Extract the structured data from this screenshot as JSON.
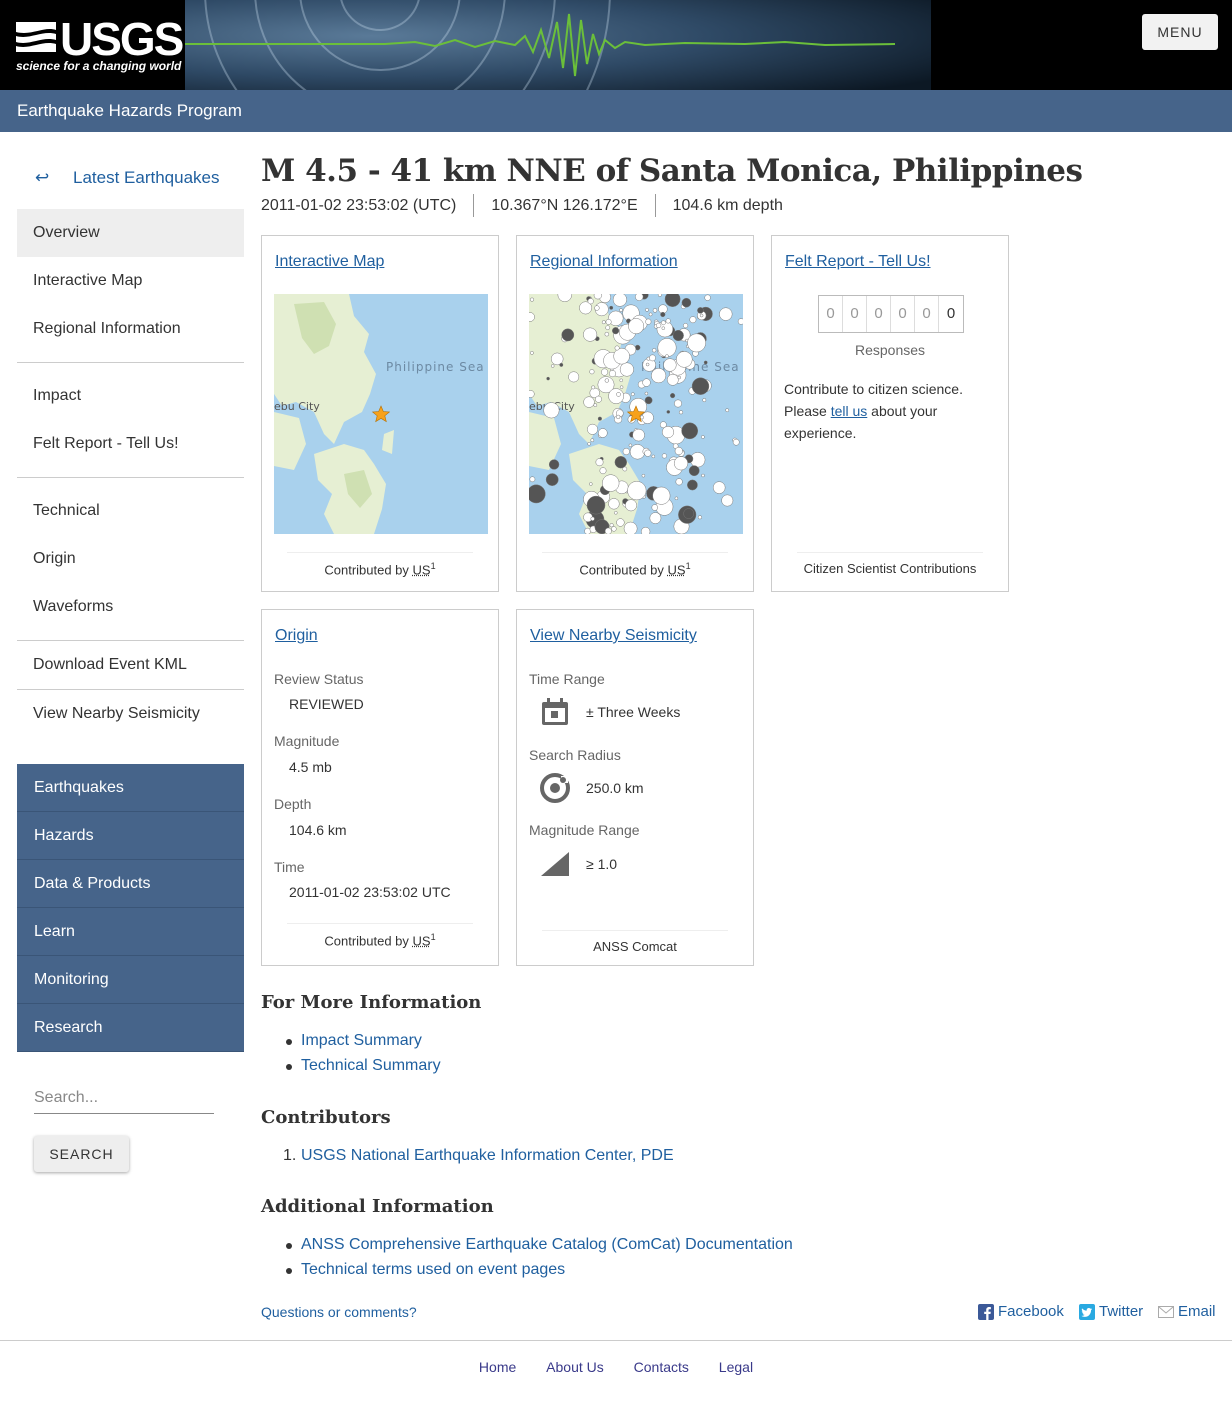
{
  "header": {
    "logo_text": "USGS",
    "logo_tagline": "science for a changing world",
    "menu_label": "MENU",
    "program_title": "Earthquake Hazards Program"
  },
  "sidebar": {
    "back_label": "Latest Earthquakes",
    "items": [
      "Overview",
      "Interactive Map",
      "Regional Information",
      "Impact",
      "Felt Report - Tell Us!",
      "Technical",
      "Origin",
      "Waveforms",
      "Download Event KML",
      "View Nearby Seismicity"
    ],
    "nav": [
      "Earthquakes",
      "Hazards",
      "Data & Products",
      "Learn",
      "Monitoring",
      "Research"
    ],
    "search_placeholder": "Search...",
    "search_button": "SEARCH"
  },
  "event": {
    "title": "M 4.5 - 41 km NNE of Santa Monica, Philippines",
    "time": "2011-01-02 23:53:02 (UTC)",
    "location": "10.367°N 126.172°E",
    "depth": "104.6 km depth"
  },
  "cards": {
    "map": {
      "title": "Interactive Map",
      "label_sea": "Philippine Sea",
      "label_city": "ebu City",
      "foot_prefix": "Contributed by",
      "foot_abbr": "US",
      "foot_sup": "1"
    },
    "regional": {
      "title": "Regional Information",
      "label_sea": "Philippine Sea",
      "label_city": "ebu City",
      "foot_prefix": "Contributed by",
      "foot_abbr": "US",
      "foot_sup": "1"
    },
    "felt": {
      "title": "Felt Report - Tell Us!",
      "digits": [
        "0",
        "0",
        "0",
        "0",
        "0",
        "0"
      ],
      "responses_label": "Responses",
      "text_before": "Contribute to citizen science. Please ",
      "text_link": "tell us",
      "text_after": " about your experience.",
      "foot": "Citizen Scientist Contributions"
    },
    "origin": {
      "title": "Origin",
      "review_label": "Review Status",
      "review_value": "REVIEWED",
      "magnitude_label": "Magnitude",
      "magnitude_value": "4.5 mb",
      "depth_label": "Depth",
      "depth_value": "104.6 km",
      "time_label": "Time",
      "time_value": "2011-01-02 23:53:02 UTC",
      "foot_prefix": "Contributed by",
      "foot_abbr": "US",
      "foot_sup": "1"
    },
    "nearby": {
      "title": "View Nearby Seismicity",
      "time_range_label": "Time Range",
      "time_range_value": "± Three Weeks",
      "radius_label": "Search Radius",
      "radius_value": "250.0 km",
      "mag_label": "Magnitude Range",
      "mag_value": "≥ 1.0",
      "foot": "ANSS Comcat"
    }
  },
  "more_info": {
    "heading": "For More Information",
    "links": [
      "Impact Summary",
      "Technical Summary"
    ]
  },
  "contributors": {
    "heading": "Contributors",
    "links": [
      "USGS National Earthquake Information Center, PDE"
    ]
  },
  "additional": {
    "heading": "Additional Information",
    "links": [
      "ANSS Comprehensive Earthquake Catalog (ComCat) Documentation",
      "Technical terms used on event pages"
    ]
  },
  "footer": {
    "questions": "Questions or comments?",
    "facebook": "Facebook",
    "twitter": "Twitter",
    "email": "Email",
    "links": [
      "Home",
      "About Us",
      "Contacts",
      "Legal"
    ]
  },
  "colors": {
    "header_blue": "#46648a",
    "link": "#1f5f9f",
    "event_star": "#f7a11a"
  }
}
